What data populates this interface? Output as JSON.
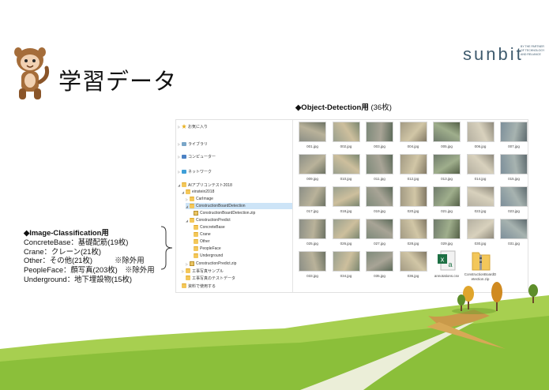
{
  "slide": {
    "title": "学習データ",
    "logo": "sunbit",
    "logo_tagline": "BY THE PARTNER OF TECHNOLOGY AND RELIANCE"
  },
  "object_detection": {
    "heading": "◆Object-Detection用",
    "count": "(36枚)"
  },
  "explorer": {
    "nav": [
      {
        "label": "お気に入り",
        "icon": "favorites-star-icon",
        "indent": 1,
        "twisty": "▷"
      },
      {
        "label": "ライブラリ",
        "icon": "library-icon",
        "indent": 1,
        "twisty": "▷"
      },
      {
        "label": "コンピューター",
        "icon": "computer-icon",
        "indent": 1,
        "twisty": "▷"
      },
      {
        "label": "ネットワーク",
        "icon": "network-icon",
        "indent": 1,
        "twisty": "▷"
      },
      {
        "label": "AIアプリコンテスト2018",
        "icon": "folder-icon",
        "indent": 1,
        "twisty": "◢"
      },
      {
        "label": "einstein2018",
        "icon": "folder-icon",
        "indent": 2,
        "twisty": "◢"
      },
      {
        "label": "CarImage",
        "icon": "folder-icon",
        "indent": 3,
        "twisty": "▷"
      },
      {
        "label": "ConstructionBoardDetection",
        "icon": "folder-icon",
        "indent": 3,
        "twisty": "◢",
        "selected": true
      },
      {
        "label": "ConstructionBoardDetection.zip",
        "icon": "zip-file-icon",
        "indent": 4,
        "twisty": ""
      },
      {
        "label": "ConstructionPredict",
        "icon": "folder-icon",
        "indent": 3,
        "twisty": "◢"
      },
      {
        "label": "ConcreteBase",
        "icon": "folder-icon",
        "indent": 4,
        "twisty": ""
      },
      {
        "label": "Crane",
        "icon": "folder-icon",
        "indent": 4,
        "twisty": ""
      },
      {
        "label": "Other",
        "icon": "folder-icon",
        "indent": 4,
        "twisty": ""
      },
      {
        "label": "PeopleFace",
        "icon": "folder-icon",
        "indent": 4,
        "twisty": ""
      },
      {
        "label": "Underground",
        "icon": "folder-icon",
        "indent": 4,
        "twisty": ""
      },
      {
        "label": "ConstructionPredict.zip",
        "icon": "zip-file-icon",
        "indent": 3,
        "twisty": "▷"
      },
      {
        "label": "工事写真サンプル",
        "icon": "folder-icon",
        "indent": 2,
        "twisty": "▷"
      },
      {
        "label": "工事写真のテストデータ",
        "icon": "folder-icon",
        "indent": 2,
        "twisty": ""
      },
      {
        "label": "資料で使用する",
        "icon": "folder-icon",
        "indent": 1,
        "twisty": ""
      }
    ],
    "files": [
      "001.jpg",
      "002.jpg",
      "003.jpg",
      "004.jpg",
      "005.jpg",
      "006.jpg",
      "007.jpg",
      "009.jpg",
      "010.jpg",
      "011.jpg",
      "012.jpg",
      "013.jpg",
      "014.jpg",
      "015.jpg",
      "017.jpg",
      "018.jpg",
      "019.jpg",
      "020.jpg",
      "021.jpg",
      "022.jpg",
      "023.jpg",
      "025.jpg",
      "026.jpg",
      "027.jpg",
      "028.jpg",
      "029.jpg",
      "030.jpg",
      "031.jpg",
      "033.jpg",
      "034.jpg",
      "035.jpg",
      "036.jpg",
      "annotations.csv",
      "ConstructionBoardDetection.zip"
    ]
  },
  "image_classification": {
    "heading": "◆Image-Classification用",
    "lines": [
      "ConcreteBase：基礎配筋(19枚)",
      "Crane：クレーン(21枚)",
      "Other：その他(21枚)　　　※除外用",
      "PeopleFace：顔写真(203枚)　※除外用",
      "Underground：地下埋設物(15枚)"
    ]
  },
  "colors": {
    "logo": "#3f5b6e",
    "selection": "#cde4f7",
    "folder": "#f3c75a",
    "grass": "#8bbf3a",
    "path": "#c99a4a"
  }
}
